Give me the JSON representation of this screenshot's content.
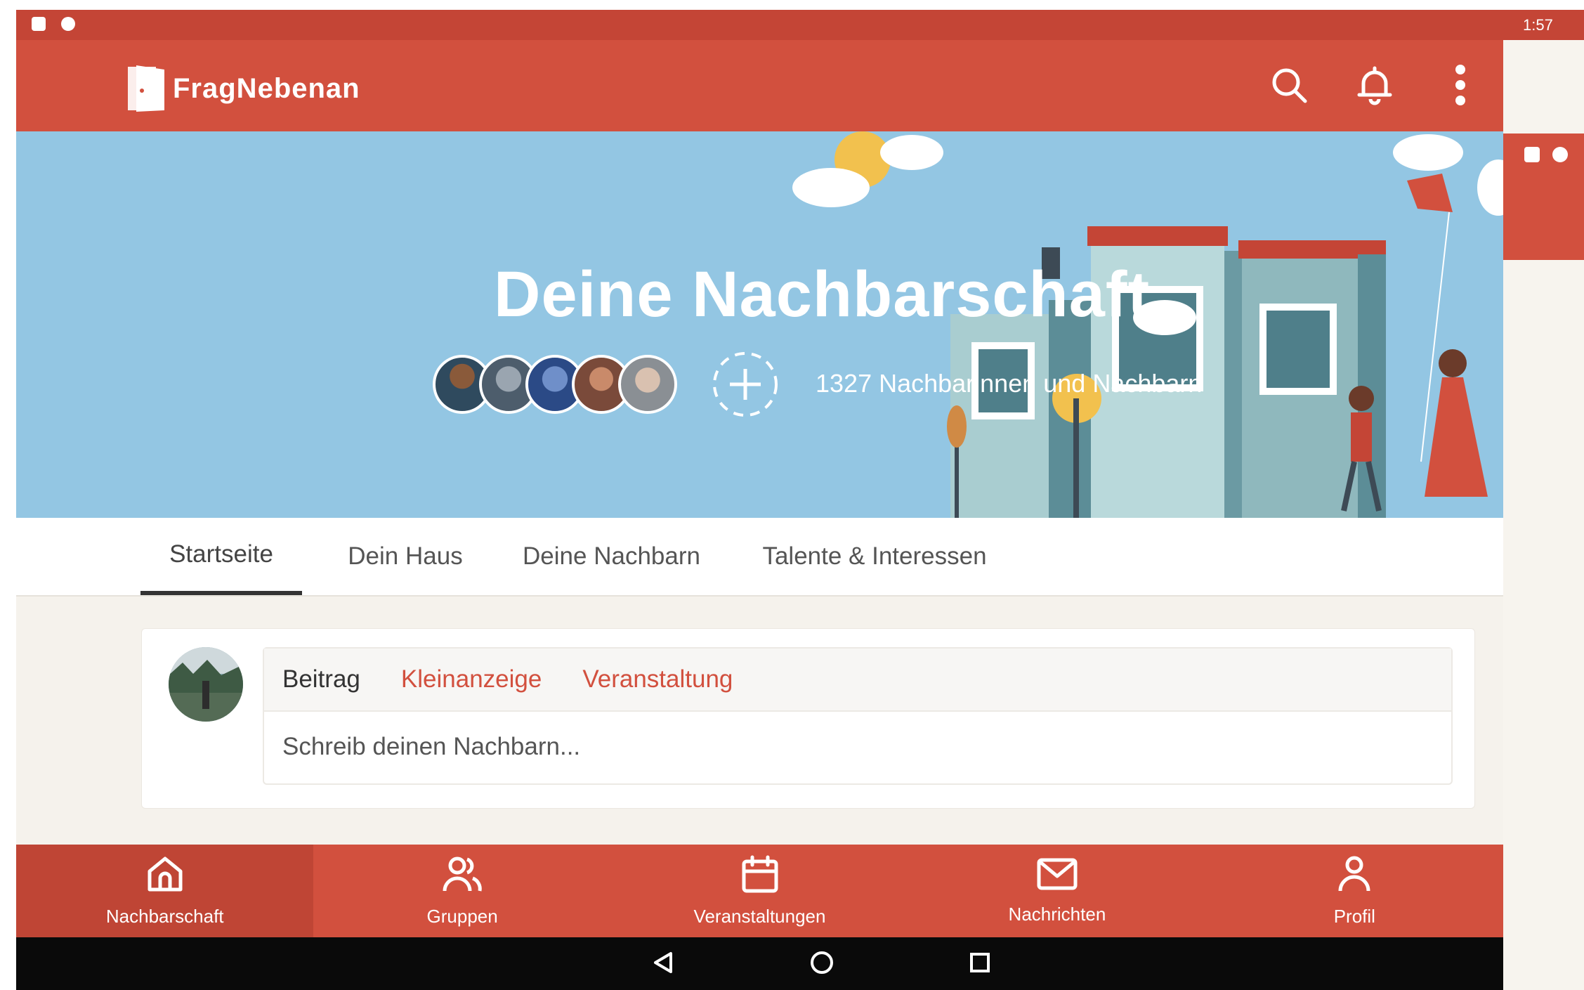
{
  "status_bar": {
    "time": "1:57"
  },
  "app_bar": {
    "logo_text": "FragNebenan",
    "actions": [
      {
        "name": "search-icon"
      },
      {
        "name": "bell-icon"
      },
      {
        "name": "more-vertical-icon"
      }
    ]
  },
  "hero": {
    "title": "Deine Nachbarschaft",
    "neighbors_count_text": "1327 Nachbarinnen und Nachbarn",
    "avatar_count": 5
  },
  "tabs": [
    {
      "label": "Startseite",
      "active": true
    },
    {
      "label": "Dein Haus",
      "active": false
    },
    {
      "label": "Deine Nachbarn",
      "active": false
    },
    {
      "label": "Talente & Interessen",
      "active": false
    }
  ],
  "composer": {
    "types": [
      {
        "label": "Beitrag"
      },
      {
        "label": "Kleinanzeige"
      },
      {
        "label": "Veranstaltung"
      }
    ],
    "placeholder": "Schreib deinen Nachbarn..."
  },
  "bottom_nav": [
    {
      "label": "Nachbarschaft",
      "icon": "home-icon",
      "active": true
    },
    {
      "label": "Gruppen",
      "icon": "users-icon",
      "active": false
    },
    {
      "label": "Veranstaltungen",
      "icon": "calendar-icon",
      "active": false
    },
    {
      "label": "Nachrichten",
      "icon": "mail-icon",
      "active": false
    },
    {
      "label": "Profil",
      "icon": "person-icon",
      "active": false
    }
  ],
  "colors": {
    "brand_red": "#d2503e",
    "status_red": "#c44536",
    "sky_blue": "#93c6e3",
    "background": "#f5f2ec"
  }
}
